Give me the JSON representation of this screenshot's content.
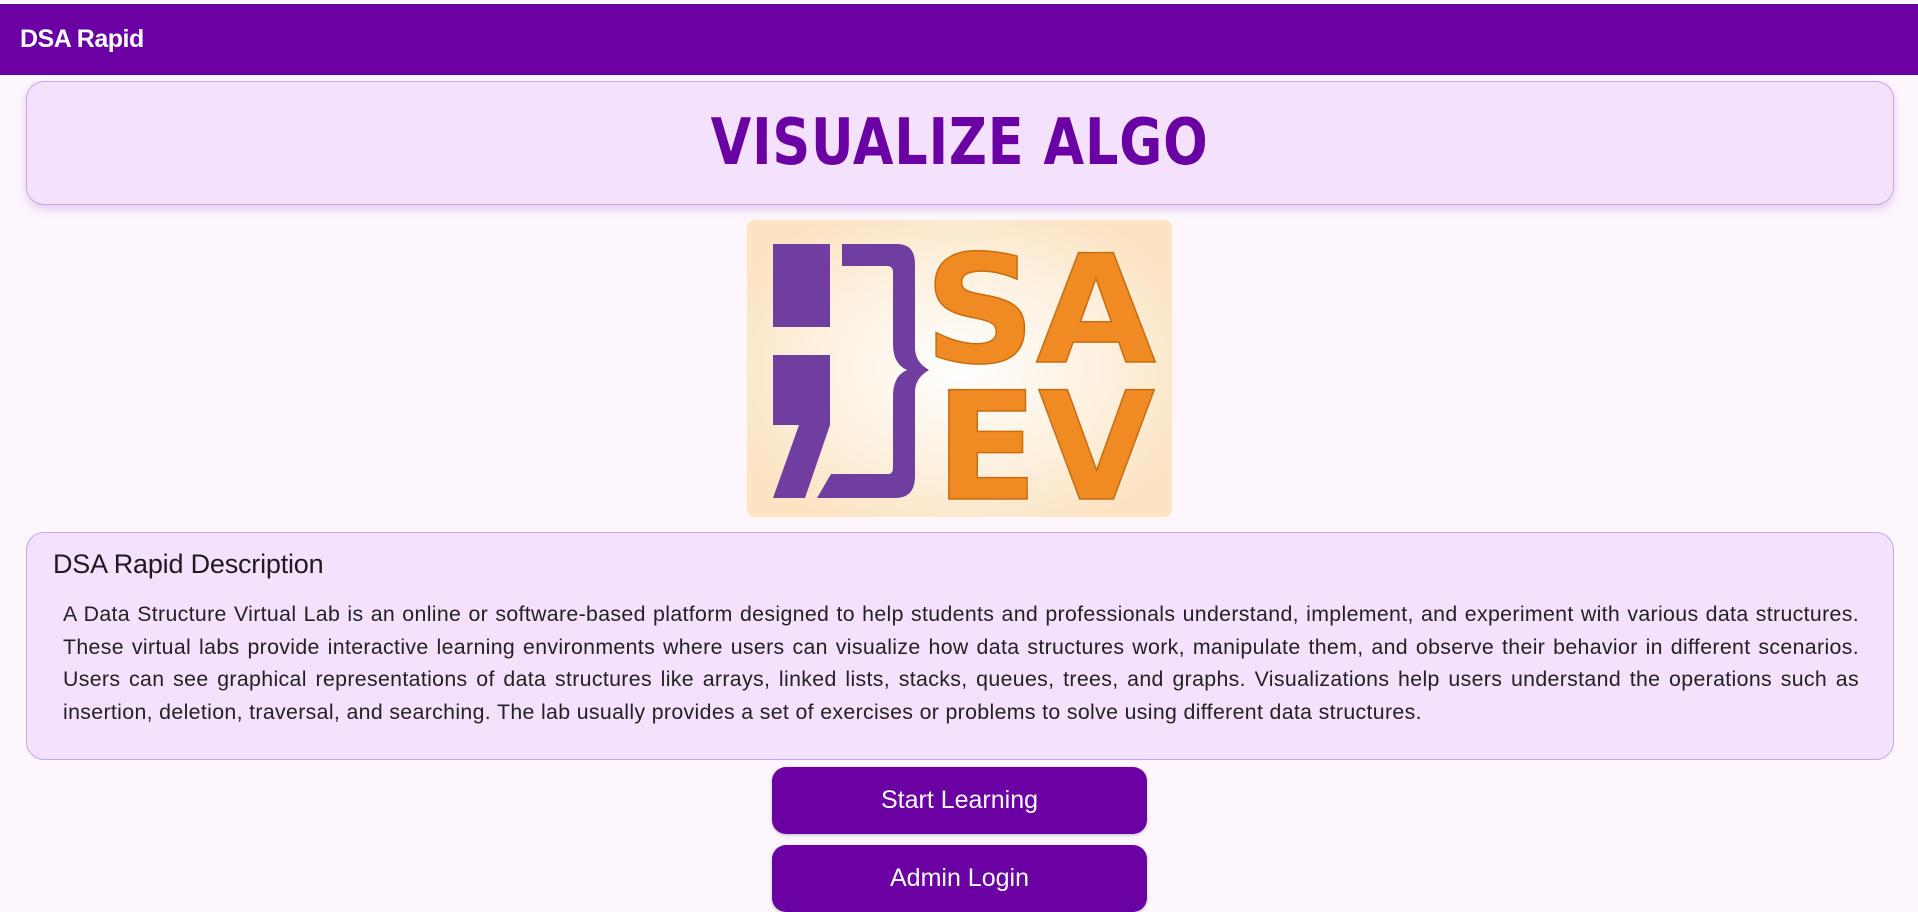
{
  "header": {
    "app_title": "DSA Rapid"
  },
  "hero": {
    "title": "VISUALIZE ALGO"
  },
  "logo": {
    "text_line1": "SA",
    "text_line2": "EV",
    "colors": {
      "purple": "#6f3e9f",
      "orange": "#ef8b22",
      "background": "#fdebd2"
    }
  },
  "description": {
    "title": "DSA Rapid Description",
    "body": "A Data Structure Virtual Lab is an online or software-based platform designed to help students and professionals understand, implement, and experiment with various data structures. These virtual labs provide interactive learning environments where users can visualize how data structures work, manipulate them, and observe their behavior in different scenarios. Users can see graphical representations of data structures like arrays, linked lists, stacks, queues, trees, and graphs. Visualizations help users understand the operations such as insertion, deletion, traversal, and searching. The lab usually provides a set of exercises or problems to solve using different data structures."
  },
  "actions": {
    "start_label": "Start Learning",
    "admin_label": "Admin Login"
  },
  "theme": {
    "primary": "#6a00a4",
    "card_background": "#f3e1fe",
    "card_border": "#c9a6ec",
    "page_background": "#fdf7fd"
  }
}
